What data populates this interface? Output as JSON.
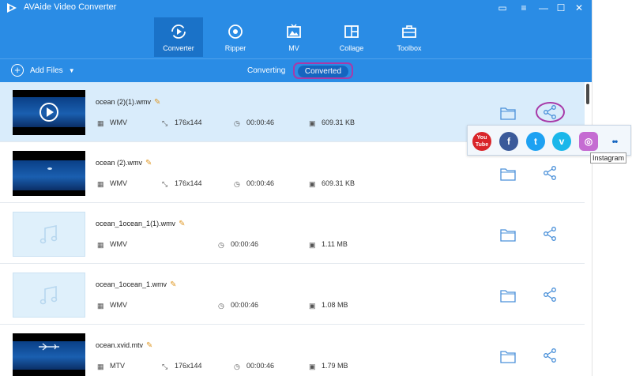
{
  "app": {
    "title": "AVAide Video Converter"
  },
  "nav": {
    "tabs": [
      {
        "label": "Converter",
        "icon": "converter-icon",
        "active": true
      },
      {
        "label": "Ripper",
        "icon": "ripper-icon",
        "active": false
      },
      {
        "label": "MV",
        "icon": "mv-icon",
        "active": false
      },
      {
        "label": "Collage",
        "icon": "collage-icon",
        "active": false
      },
      {
        "label": "Toolbox",
        "icon": "toolbox-icon",
        "active": false
      }
    ]
  },
  "toolbar": {
    "add_files_label": "Add Files",
    "tab_converting": "Converting",
    "tab_converted": "Converted"
  },
  "files": [
    {
      "name": "ocean (2)(1).wmv",
      "format": "WMV",
      "resolution": "176x144",
      "duration": "00:00:46",
      "size": "609.31 KB",
      "thumb": "video",
      "selected": true
    },
    {
      "name": "ocean (2).wmv",
      "format": "WMV",
      "resolution": "176x144",
      "duration": "00:00:46",
      "size": "609.31 KB",
      "thumb": "video",
      "selected": false
    },
    {
      "name": "ocean_1ocean_1(1).wmv",
      "format": "WMV",
      "resolution": "",
      "duration": "00:00:46",
      "size": "1.11 MB",
      "thumb": "audio",
      "selected": false
    },
    {
      "name": "ocean_1ocean_1.wmv",
      "format": "WMV",
      "resolution": "",
      "duration": "00:00:46",
      "size": "1.08 MB",
      "thumb": "audio",
      "selected": false
    },
    {
      "name": "ocean.xvid.mtv",
      "format": "MTV",
      "resolution": "176x144",
      "duration": "00:00:46",
      "size": "1.79 MB",
      "thumb": "video",
      "selected": false
    }
  ],
  "share_popup": {
    "services": [
      {
        "name": "YouTube",
        "icon": "youtube-icon",
        "glyph": "You Tube",
        "color": "#d9252a"
      },
      {
        "name": "Facebook",
        "icon": "facebook-icon",
        "glyph": "f",
        "color": "#3b5a9a"
      },
      {
        "name": "Twitter",
        "icon": "twitter-icon",
        "glyph": "t",
        "color": "#1da1f2"
      },
      {
        "name": "Vimeo",
        "icon": "vimeo-icon",
        "glyph": "v",
        "color": "#1ab7ea"
      },
      {
        "name": "Instagram",
        "icon": "instagram-icon",
        "glyph": "◎",
        "color": "#c56cd2"
      },
      {
        "name": "Flickr",
        "icon": "flickr-icon",
        "glyph": "••",
        "color": "#f2f7fc"
      }
    ],
    "tooltip": "Instagram"
  },
  "colors": {
    "accent": "#2a8ce5",
    "highlight": "#a83aa8",
    "selected_row": "#d9ecfb"
  }
}
